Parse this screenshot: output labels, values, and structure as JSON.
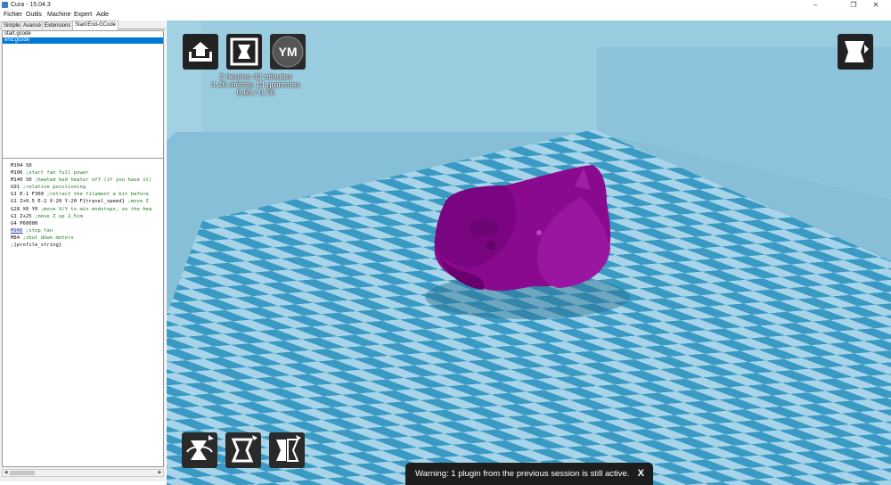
{
  "window": {
    "title": "Cura - 15.04.3",
    "minimize": "–",
    "maximize": "❐",
    "close": "✕"
  },
  "menu": [
    "Fichier",
    "Outils",
    "Machine",
    "Expert",
    "Aide"
  ],
  "tabs": [
    "Simple",
    "Avancé",
    "Extensions",
    "Start/End-GCode"
  ],
  "active_tab": "Start/End-GCode",
  "gcode_files": [
    "start.gcode",
    "end.gcode"
  ],
  "selected_file": "end.gcode",
  "gcode_lines": [
    {
      "code": "M104 S0",
      "comment": ""
    },
    {
      "code": "M106 ",
      "comment": ";start fan full power"
    },
    {
      "code": "M140 S0 ",
      "comment": ";heated bed heater off (if you have it)"
    },
    {
      "code": "G91 ",
      "comment": ";relative positioning"
    },
    {
      "code": "G1 E-1 F300 ",
      "comment": ";retract the filament a bit before"
    },
    {
      "code": "G1 Z+0.5 E-2 X-20 Y-20 F{travel_speed} ",
      "comment": ";move Z"
    },
    {
      "code": "G28 X0 Y0 ",
      "comment": ";move X/Y to min endstops, so the hea"
    },
    {
      "code": "G1 Z+25 ",
      "comment": ";move Z up 2,5cm"
    },
    {
      "code": "G4 P60000",
      "comment": ""
    },
    {
      "code": "M906",
      "comment": " ;stop fan",
      "kw": true
    },
    {
      "code": "M84 ",
      "comment": ";shut down motors"
    },
    {
      "code": ";{profile_string}",
      "comment": ""
    }
  ],
  "viewport": {
    "print_time": "2 heures 42 minutes",
    "material": "4.46 mètres 14 grammes",
    "cost": "0.63 / 0.70",
    "avatar_initials": "YM",
    "colors": {
      "background": "#8fc6dc",
      "floor_dark": "#3a9ac4",
      "floor_light": "#a7d4e8",
      "model": "#8a0a8e",
      "model_shadow": "#5a0060"
    },
    "icons": {
      "load": "load-model-icon",
      "print": "print-icon",
      "avatar": "avatar-icon",
      "view_mode": "view-mode-icon",
      "rotate": "rotate-icon",
      "scale": "scale-icon",
      "mirror": "mirror-icon"
    }
  },
  "warning": {
    "text": "Warning: 1 plugin from the previous session is still active.",
    "close": "X"
  }
}
